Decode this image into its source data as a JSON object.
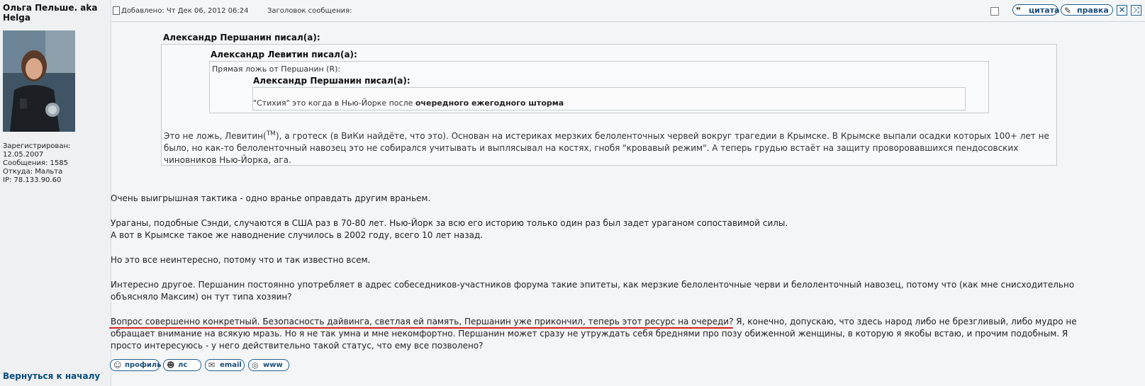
{
  "author": {
    "name": "Ольга Пельше. aka Helga",
    "info": [
      "Зарегистрирован:",
      "12.05.2007",
      "Сообщения: 1585",
      "Откуда: Мальта",
      "IP: 78.133.90.60"
    ],
    "back_link": "Вернуться к началу"
  },
  "header": {
    "posted": "Добавлено: Чт Дек 06, 2012 06:24",
    "subject": "Заголовок сообщения:",
    "quote_label": "цитата",
    "edit_label": "правка",
    "delete_icon": "close-x-icon",
    "ip_icon": "crossed-arrows-icon"
  },
  "quote1": {
    "title": "Александр Першанин писал(а):",
    "text_before_tm": "Это не ложь, Левитин(",
    "tm": "TM",
    "text_after_tm": "), а гротеск (в ВиКи найдёте, что это). Основан на истериках мерзких белоленточных червей вокруг трагедии в Крымске. В Крымске выпали осадки которых 100+ лет не было, но как-то белоленточный навозец это не собирался учитывать и выплясывал на костях, гнобя \"кровавый режим\". А теперь грудью встаёт на защиту проворовавшихся пендосовских чиновников Нью-Йорка, ага."
  },
  "quote2": {
    "title": "Александр Левитин писал(а):",
    "text": "Прямая ложь от Першанин (R):"
  },
  "quote3": {
    "title": "Александр Першанин писал(а):",
    "text_plain": "\"Стихия\" это когда в Нью-Йорке после ",
    "text_bold": "очередного ежегодного шторма"
  },
  "body": {
    "p1": "Очень выигрышная тактика - одно вранье оправдать другим враньем.",
    "p2": "Ураганы, подобные Сэнди, случаются в США раз в 70-80 лет. Нью-Йорк за всю его историю только один раз был задет ураганом сопоставимой силы.",
    "p3": "А вот в Крымске такое же наводнение случилось в 2002 году, всего 10 лет назад.",
    "p4": "Но это все неинтересно, потому что и так известно всем.",
    "p5": "Интересно другое. Першанин постоянно употребляет в адрес собеседников-участников форума такие эпитеты, как мерзкие белоленточные черви и белоленточный навозец, потому что (как мне снисходительно объясняло Максим) он тут типа хозяин?",
    "p6": "Вопрос совершенно конкретный. Безопасность дайвинга, светлая ей память, Першанин уже прикончил, теперь этот ресурс на очереди? Я, конечно, допускаю, что здесь народ либо не брезгливый, либо мудро не обращает внимание на всякую мразь. Но я не так умна и мне некомфортно. Першанин может сразу не утруждать себя бреднями про позу обиженной женщины, в которую я якобы встаю, и прочим подобным. Я просто интересуюсь - у него действительно такой статус, что ему все позволено?"
  },
  "footer": {
    "profile": "профиль",
    "pm": "лс",
    "email": "email",
    "www": "www"
  },
  "colors": {
    "underline": "#d91f1f",
    "button_border": "#1f5f90",
    "link": "#0a4d7a"
  }
}
